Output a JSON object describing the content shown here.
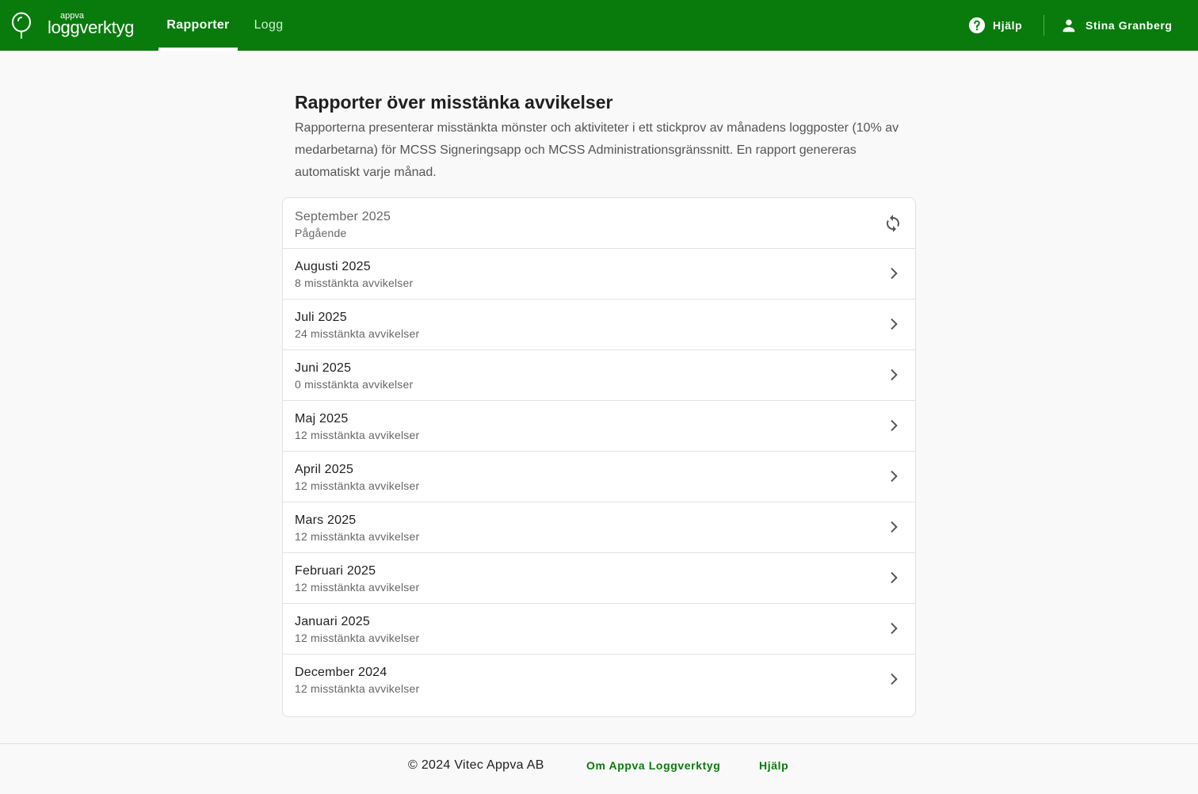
{
  "brand": {
    "small": "appva",
    "name": "loggverktyg",
    "primary_color": "#087b0c"
  },
  "nav": {
    "tabs": [
      {
        "label": "Rapporter",
        "active": true
      },
      {
        "label": "Logg",
        "active": false
      }
    ],
    "help_label": "Hjälp",
    "help_icon": "help-circle-icon",
    "user_name": "Stina Granberg",
    "user_icon": "person-icon"
  },
  "main": {
    "title": "Rapporter över misstänka avvikelser",
    "description": "Rapporterna presenterar misstänkta mönster och aktiviteter i ett stickprov av månadens loggposter (10% av medarbetarna) för MCSS Signeringsapp och MCSS Administrationsgränssnitt. En rapport genereras automatiskt varje månad."
  },
  "reports": [
    {
      "month": "September 2025",
      "status": "Pågående",
      "icon": "refresh-icon",
      "in_progress": true
    },
    {
      "month": "Augusti 2025",
      "status": "8 misstänkta avvikelser",
      "icon": "chevron-right-icon"
    },
    {
      "month": "Juli 2025",
      "status": "24 misstänkta avvikelser",
      "icon": "chevron-right-icon"
    },
    {
      "month": "Juni 2025",
      "status": "0 misstänkta avvikelser",
      "icon": "chevron-right-icon"
    },
    {
      "month": "Maj 2025",
      "status": "12 misstänkta avvikelser",
      "icon": "chevron-right-icon"
    },
    {
      "month": "April 2025",
      "status": "12 misstänkta avvikelser",
      "icon": "chevron-right-icon"
    },
    {
      "month": "Mars 2025",
      "status": "12 misstänkta avvikelser",
      "icon": "chevron-right-icon"
    },
    {
      "month": "Februari 2025",
      "status": "12 misstänkta avvikelser",
      "icon": "chevron-right-icon"
    },
    {
      "month": "Januari 2025",
      "status": "12 misstänkta avvikelser",
      "icon": "chevron-right-icon"
    },
    {
      "month": "December 2024",
      "status": "12 misstänkta avvikelser",
      "icon": "chevron-right-icon"
    }
  ],
  "footer": {
    "copyright": "© 2024 Vitec Appva AB",
    "about_link": "Om Appva Loggverktyg",
    "help_link": "Hjälp"
  }
}
